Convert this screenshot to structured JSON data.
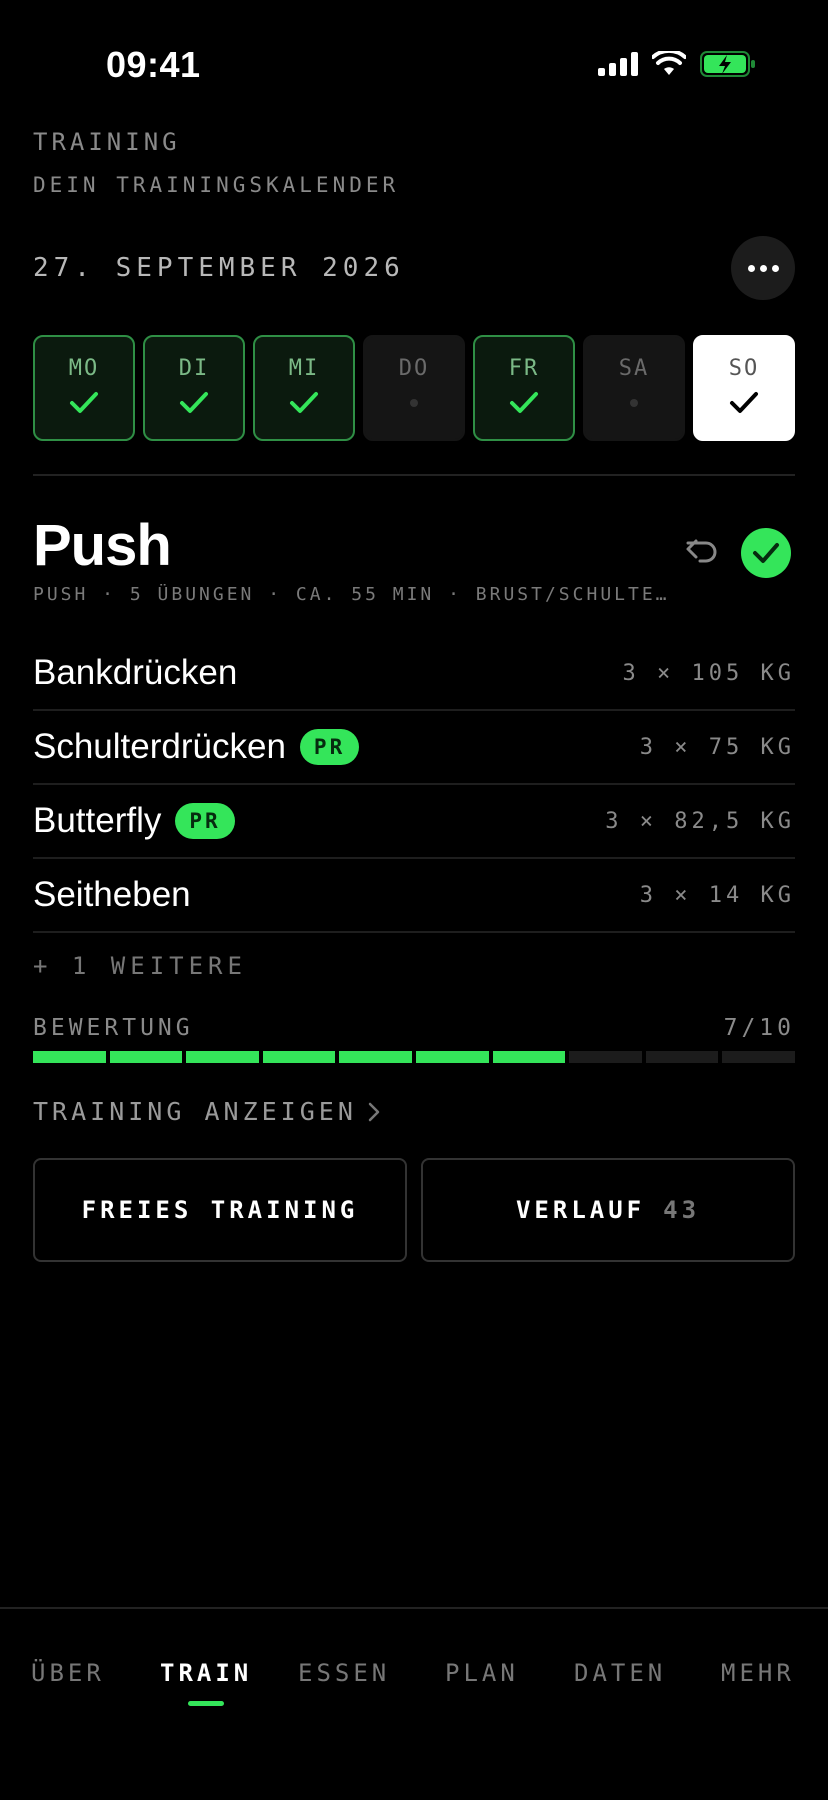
{
  "status_bar": {
    "time": "09:41",
    "icons": [
      "signal-icon",
      "wifi-icon",
      "battery-charging-icon"
    ]
  },
  "header": {
    "title": "TRAINING",
    "subtitle": "DEIN TRAININGSKALENDER",
    "date": "27. SEPTEMBER 2026"
  },
  "week": [
    {
      "label": "MO",
      "state": "done"
    },
    {
      "label": "DI",
      "state": "done"
    },
    {
      "label": "MI",
      "state": "done"
    },
    {
      "label": "DO",
      "state": "rest"
    },
    {
      "label": "FR",
      "state": "done"
    },
    {
      "label": "SA",
      "state": "rest"
    },
    {
      "label": "SO",
      "state": "today"
    }
  ],
  "workout": {
    "title": "Push",
    "meta": "PUSH · 5 ÜBUNGEN · CA. 55 MIN · BRUST/SCHULTE…",
    "exercises": [
      {
        "name": "Bankdrücken",
        "value": "3 × 105 KG",
        "pr": ""
      },
      {
        "name": "Schulterdrücken",
        "value": "3 × 75 KG",
        "pr": "PR"
      },
      {
        "name": "Butterfly",
        "value": "3 × 82,5 KG",
        "pr": "PR"
      },
      {
        "name": "Seitheben",
        "value": "3 × 14 KG",
        "pr": ""
      }
    ],
    "more": "+ 1 WEITERE",
    "rating_label": "BEWERTUNG",
    "rating_text": "7/10",
    "rating_value": 7,
    "rating_max": 10,
    "show_link": "TRAINING ANZEIGEN"
  },
  "buttons": {
    "free_training": "FREIES TRAINING",
    "history": "VERLAUF",
    "history_count": "43"
  },
  "tabs": [
    {
      "label": "ÜBER",
      "active": false
    },
    {
      "label": "TRAIN",
      "active": true
    },
    {
      "label": "ESSEN",
      "active": false
    },
    {
      "label": "PLAN",
      "active": false
    },
    {
      "label": "DATEN",
      "active": false
    },
    {
      "label": "MEHR",
      "active": false
    }
  ],
  "colors": {
    "accent": "#34e55a",
    "background": "#000000",
    "muted": "#8a8a8a"
  }
}
